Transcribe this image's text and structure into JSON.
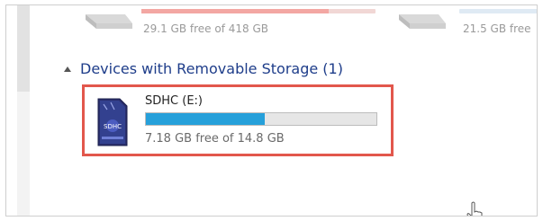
{
  "drives_partial": [
    {
      "free_text": "29.1 GB free of 418 GB",
      "used_fraction": 0.8,
      "bar_color": "#f3a7a3"
    },
    {
      "free_text": "21.5 GB free",
      "bar_color": "#dfeaf4"
    }
  ],
  "group": {
    "title": "Devices with Removable Storage (1)",
    "collapsed": false
  },
  "device": {
    "name": "SDHC (E:)",
    "free_text": "7.18 GB free of 14.8 GB",
    "used_fraction": 0.515,
    "bar_color": "#26a0da",
    "icon": "sd-card-icon",
    "icon_label": "SDHC",
    "highlight_color": "#e2574c"
  }
}
